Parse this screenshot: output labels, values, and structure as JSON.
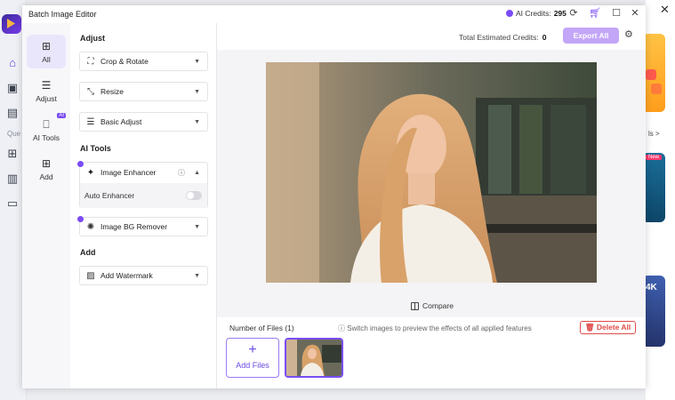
{
  "dialog": {
    "title": "Batch Image Editor",
    "credits_label": "AI Credits:",
    "credits_value": "295"
  },
  "tabs": [
    {
      "label": "All"
    },
    {
      "label": "Adjust"
    },
    {
      "label": "AI Tools",
      "badge": "AI"
    },
    {
      "label": "Add"
    }
  ],
  "panel": {
    "adjust_header": "Adjust",
    "crop_rotate": "Crop & Rotate",
    "resize": "Resize",
    "basic_adjust": "Basic Adjust",
    "ai_tools_header": "AI Tools",
    "image_enhancer": "Image Enhancer",
    "auto_enhancer": "Auto Enhancer",
    "bg_remover": "Image BG Remover",
    "add_header": "Add",
    "add_watermark": "Add Watermark"
  },
  "main": {
    "est_label": "Total Estimated Credits:",
    "est_value": "0",
    "export_all": "Export All",
    "compare": "Compare",
    "num_files": "Number of Files (1)",
    "hint": "Switch images to preview the effects of all applied features",
    "delete_all": "Delete All",
    "add_files": "Add Files"
  },
  "host": {
    "quick_label": "Que",
    "tools_link": "ls >",
    "new_badge": "New",
    "card_text": "4K"
  },
  "colors": {
    "accent": "#7a4cf5",
    "export_bg": "#c3a6f7",
    "danger": "#e04b4b"
  }
}
